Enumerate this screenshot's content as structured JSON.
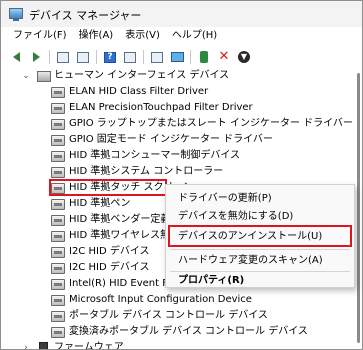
{
  "window": {
    "title": "デバイス マネージャー"
  },
  "menu": [
    "ファイル(F)",
    "操作(A)",
    "表示(V)",
    "ヘルプ(H)"
  ],
  "toolbar": {
    "buttons": [
      "back-icon",
      "forward-icon",
      "properties-icon",
      "show-hide-icon",
      "help-icon",
      "action-icon",
      "scan-hardware-icon",
      "monitor-icon",
      "enable-device-icon",
      "uninstall-icon",
      "disable-icon"
    ]
  },
  "tree": {
    "category": "ヒューマン インターフェイス デバイス",
    "devices": [
      "ELAN HID Class Filter Driver",
      "ELAN PrecisionTouchpad Filter Driver",
      "GPIO ラップトップまたはスレート インジケーター ドライバー",
      "GPIO 固定モード インジケーター ドライバー",
      "HID 準拠コンシューマー制御デバイス",
      "HID 準拠システム コントローラー",
      "HID 準拠タッチ スクリーン",
      "HID 準拠ペン",
      "HID 準拠ベンダー定義デバイス",
      "HID 準拠ワイヤレス無線コントロール",
      "I2C HID デバイス",
      "I2C HID デバイス",
      "Intel(R) HID Event Filter",
      "Microsoft Input Configuration Device",
      "ポータブル デバイス コントロール デバイス",
      "変換済みポータブル デバイス コントロール デバイス"
    ],
    "next_category": "ファームウェア",
    "selected_index": 6
  },
  "context_menu": {
    "items": [
      "ドライバーの更新(P)",
      "デバイスを無効にする(D)",
      "デバイスのアンインストール(U)",
      "ハードウェア変更のスキャン(A)",
      "プロパティ(R)"
    ],
    "highlighted_index": 2
  },
  "colors": {
    "highlight_border": "#e0141e",
    "selection": "#cce8ff"
  }
}
